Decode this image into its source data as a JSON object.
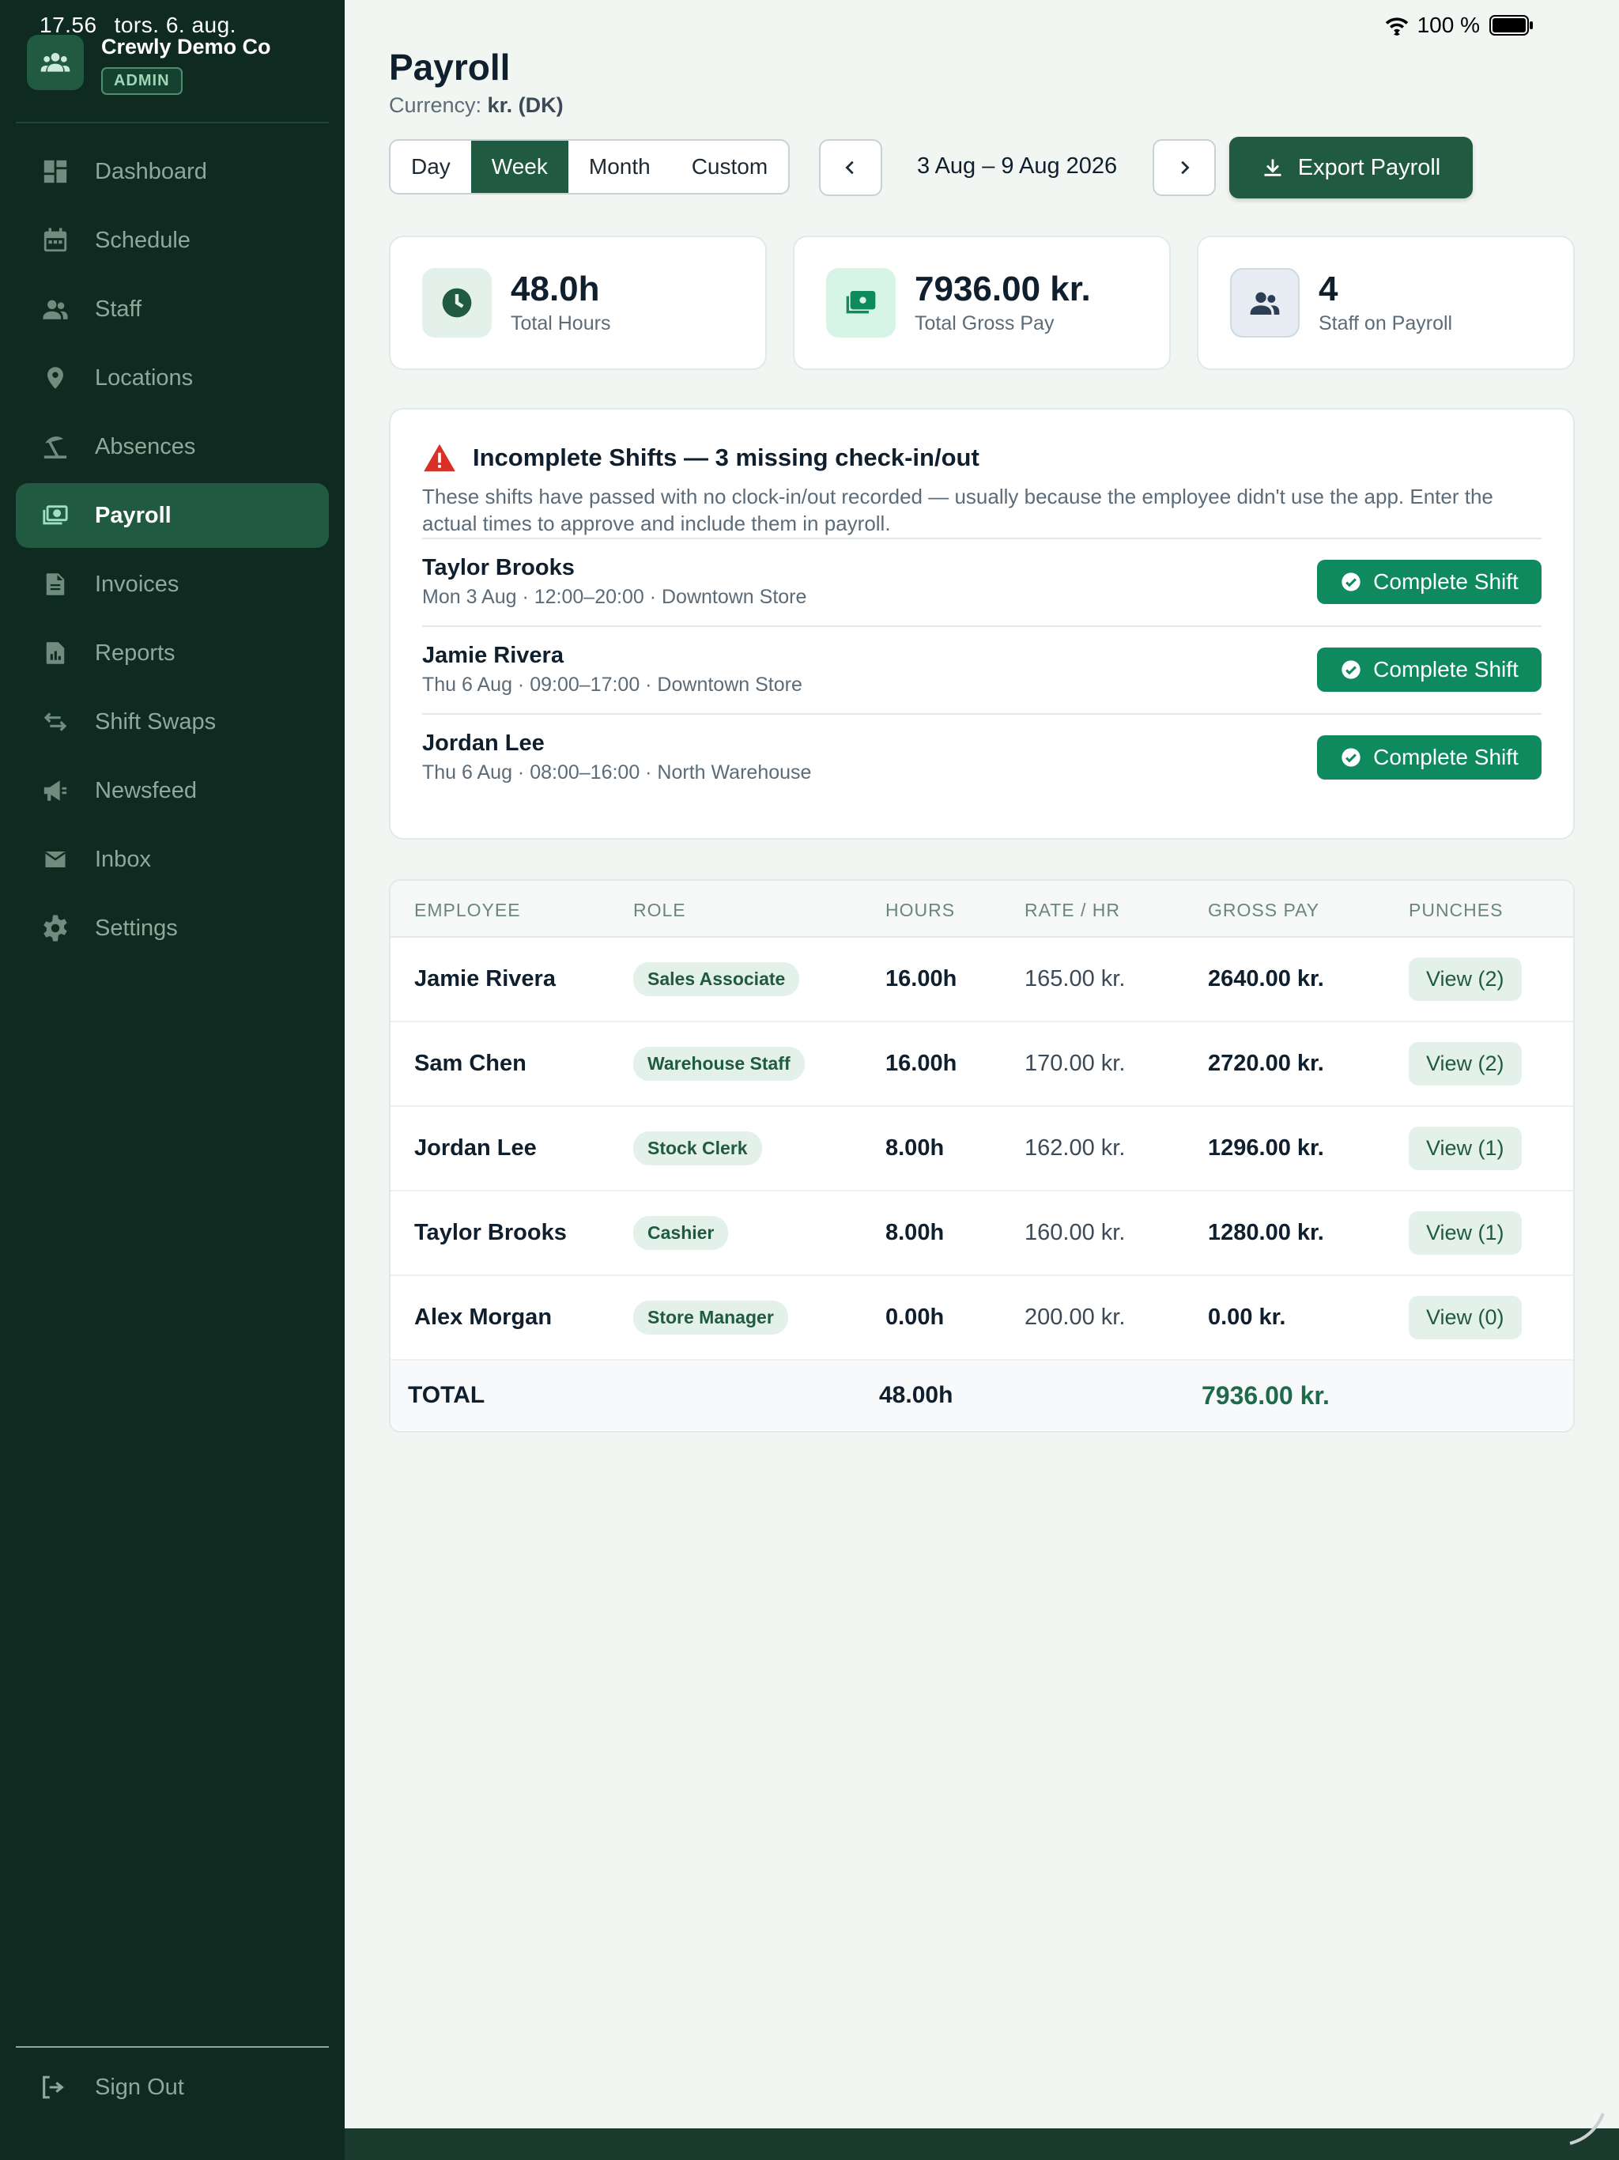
{
  "status": {
    "time": "17.56",
    "date": "tors. 6. aug.",
    "battery": "100 %"
  },
  "org": {
    "name": "Crewly Demo Co",
    "badge": "ADMIN"
  },
  "sidebar": {
    "items": [
      {
        "label": "Dashboard",
        "icon": "dashboard-icon"
      },
      {
        "label": "Schedule",
        "icon": "calendar-icon"
      },
      {
        "label": "Staff",
        "icon": "people-icon"
      },
      {
        "label": "Locations",
        "icon": "pin-icon"
      },
      {
        "label": "Absences",
        "icon": "beach-icon"
      },
      {
        "label": "Payroll",
        "icon": "cash-icon",
        "active": true
      },
      {
        "label": "Invoices",
        "icon": "document-icon"
      },
      {
        "label": "Reports",
        "icon": "report-icon"
      },
      {
        "label": "Shift Swaps",
        "icon": "swap-icon"
      },
      {
        "label": "Newsfeed",
        "icon": "megaphone-icon"
      },
      {
        "label": "Inbox",
        "icon": "mail-icon"
      },
      {
        "label": "Settings",
        "icon": "gear-icon"
      }
    ],
    "signout": "Sign Out"
  },
  "page": {
    "title": "Payroll",
    "currency_label": "Currency:",
    "currency_value": "kr. (DK)"
  },
  "toolbar": {
    "periods": [
      "Day",
      "Week",
      "Month",
      "Custom"
    ],
    "active_period": "Week",
    "date_range": "3 Aug – 9 Aug 2026",
    "export_label": "Export Payroll"
  },
  "stats": [
    {
      "value": "48.0h",
      "label": "Total Hours"
    },
    {
      "value": "7936.00 kr.",
      "label": "Total Gross Pay"
    },
    {
      "value": "4",
      "label": "Staff on Payroll"
    }
  ],
  "incomplete": {
    "title": "Incomplete Shifts — 3 missing check-in/out",
    "description": "These shifts have passed with no clock-in/out recorded — usually because the employee didn't use the app. Enter the actual times to approve and include them in payroll.",
    "button_label": "Complete Shift",
    "shifts": [
      {
        "name": "Taylor Brooks",
        "meta": "Mon 3 Aug · 12:00–20:00 · Downtown Store"
      },
      {
        "name": "Jamie Rivera",
        "meta": "Thu 6 Aug · 09:00–17:00 · Downtown Store"
      },
      {
        "name": "Jordan Lee",
        "meta": "Thu 6 Aug · 08:00–16:00 · North Warehouse"
      }
    ]
  },
  "table": {
    "headers": {
      "employee": "EMPLOYEE",
      "role": "ROLE",
      "hours": "HOURS",
      "rate": "RATE / HR",
      "gross": "GROSS PAY",
      "punches": "PUNCHES"
    },
    "rows": [
      {
        "name": "Jamie Rivera",
        "role": "Sales Associate",
        "hours": "16.00h",
        "rate": "165.00 kr.",
        "gross": "2640.00 kr.",
        "punches": "View (2)"
      },
      {
        "name": "Sam Chen",
        "role": "Warehouse Staff",
        "hours": "16.00h",
        "rate": "170.00 kr.",
        "gross": "2720.00 kr.",
        "punches": "View (2)"
      },
      {
        "name": "Jordan Lee",
        "role": "Stock Clerk",
        "hours": "8.00h",
        "rate": "162.00 kr.",
        "gross": "1296.00 kr.",
        "punches": "View (1)"
      },
      {
        "name": "Taylor Brooks",
        "role": "Cashier",
        "hours": "8.00h",
        "rate": "160.00 kr.",
        "gross": "1280.00 kr.",
        "punches": "View (1)"
      },
      {
        "name": "Alex Morgan",
        "role": "Store Manager",
        "hours": "0.00h",
        "rate": "200.00 kr.",
        "gross": "0.00 kr.",
        "punches": "View (0)"
      }
    ],
    "total": {
      "label": "TOTAL",
      "hours": "48.00h",
      "gross": "7936.00 kr."
    }
  },
  "colors": {
    "sidebar_bg": "#0f2a20",
    "accent": "#1f5a41",
    "success": "#0f8a5f",
    "warning": "#d93025"
  }
}
